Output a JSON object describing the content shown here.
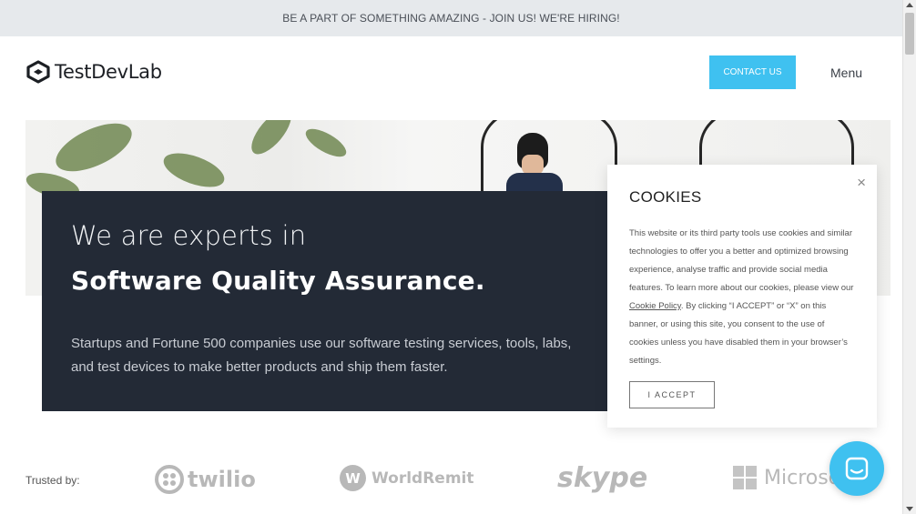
{
  "announcement": {
    "text": "BE A PART OF SOMETHING AMAZING - JOIN US! WE'RE HIRING!"
  },
  "header": {
    "logo_text": "TestDevLab",
    "contact_label": "CONTACT US",
    "menu_label": "Menu"
  },
  "hero": {
    "line1": "We are experts in",
    "line2": "Software Quality Assurance.",
    "description": "Startups and Fortune 500 companies use our software testing services, tools, labs, and test devices to make better products and ship them faster."
  },
  "trusted": {
    "label": "Trusted by:",
    "brands": [
      "twilio",
      "WorldRemit",
      "skype",
      "Microsoft"
    ]
  },
  "cookie": {
    "title": "COOKIES",
    "close_symbol": "×",
    "text_before_link": "This website or its third party tools use cookies and similar technologies to offer you a better and optimized browsing experience, analyse traffic and provide social media features. To learn more about our cookies, please view our ",
    "link_text": "Cookie Policy",
    "text_after_link": ". By clicking “I ACCEPT” or “X” on this banner, or using this site, you consent to the use of cookies unless you have disabled them in your browser’s settings.",
    "accept_label": "I ACCEPT"
  },
  "colors": {
    "accent": "#3fc1f0",
    "dark_card": "#232a36",
    "announce_bg": "#e6e9ec"
  },
  "icons": {
    "close": "close-icon",
    "chat": "chat-icon",
    "logo": "testdevlab-logo-icon"
  }
}
